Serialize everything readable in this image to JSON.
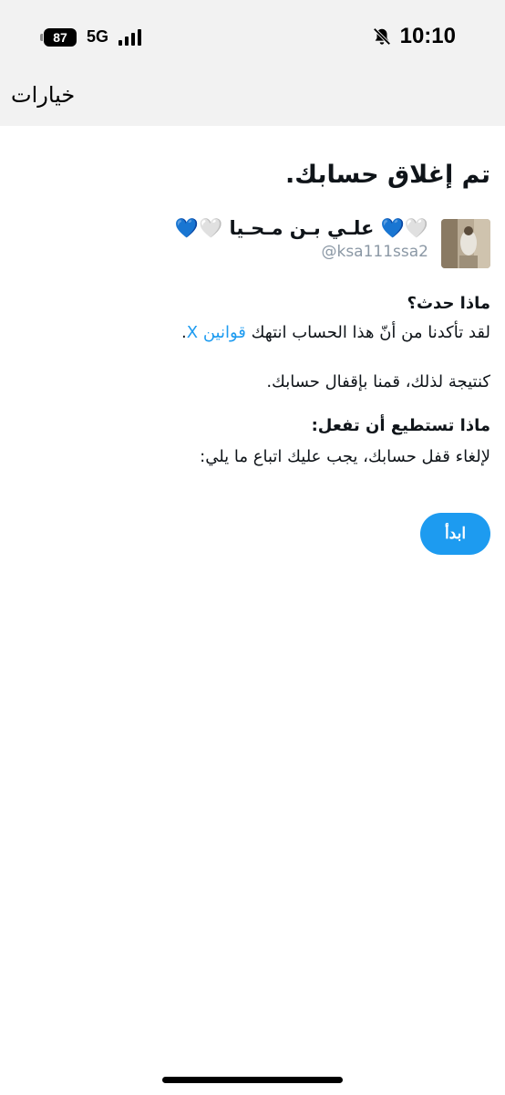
{
  "status_bar": {
    "time": "10:10",
    "battery": "87",
    "network": "5G",
    "icons": [
      "bell-slash-icon",
      "signal-bars-icon",
      "battery-icon"
    ]
  },
  "nav": {
    "title": "خيارات"
  },
  "main": {
    "title": "تم إغلاق حسابك.",
    "account": {
      "display_name": "🤍💙 علـي بـن مـحـيا 🤍💙",
      "handle": "@ksa111ssa2"
    },
    "what_happened_heading": "ماذا حدث؟",
    "what_happened_text": "لقد تأكدنا من أنّ هذا الحساب انتهك",
    "rules_link": "قوانين X",
    "period": ".",
    "result_text": "كنتيجة لذلك، قمنا بإقفال حسابك.",
    "what_can_do_heading": "ماذا تستطيع أن تفعل:",
    "unlock_text": "لإلغاء قفل حسابك، يجب عليك اتباع ما يلي:",
    "start_button": "ابدأ"
  },
  "colors": {
    "accent": "#1d9bf0",
    "bar_bg": "#f2f2f2",
    "text": "#0f1419",
    "muted": "#8b98a5"
  }
}
